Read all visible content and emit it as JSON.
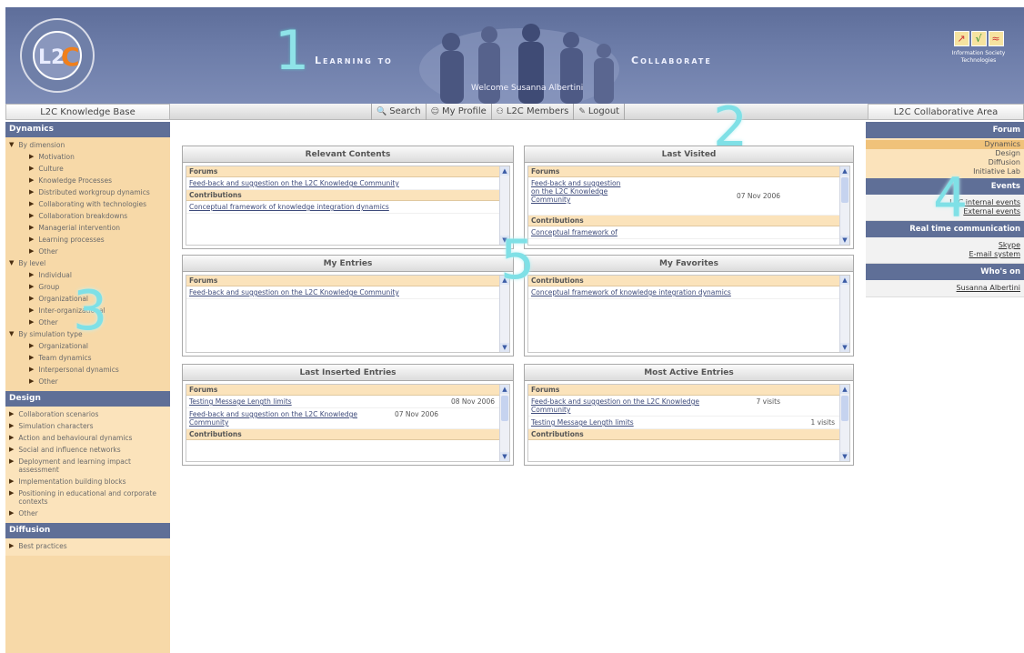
{
  "header": {
    "logo_text": "L2C",
    "logo_ring_text": "LEARNING TO COLLABORATE",
    "title_left": "Learning to",
    "title_right": "Collaborate",
    "welcome": "Welcome Susanna Albertini",
    "info_society_line1": "Information Society",
    "info_society_line2": "Technologies"
  },
  "toolbar": {
    "left_title": "L2C Knowledge Base",
    "right_title": "L2C Collaborative Area",
    "items": [
      {
        "label": "Search",
        "icon": "search-icon"
      },
      {
        "label": "My Profile",
        "icon": "profile-icon"
      },
      {
        "label": "L2C Members",
        "icon": "members-icon"
      },
      {
        "label": "Logout",
        "icon": "logout-icon"
      }
    ]
  },
  "annotations": [
    "1",
    "2",
    "3",
    "4",
    "5"
  ],
  "left": {
    "dynamics_title": "Dynamics",
    "by_dimension": "By dimension",
    "dimension_items": [
      "Motivation",
      "Culture",
      "Knowledge Processes",
      "Distributed workgroup dynamics",
      "Collaborating with technologies",
      "Collaboration breakdowns",
      "Managerial intervention",
      "Learning processes",
      "Other"
    ],
    "by_level": "By level",
    "level_items": [
      "Individual",
      "Group",
      "Organizational",
      "Inter-organizational",
      "Other"
    ],
    "by_simulation": "By simulation type",
    "simulation_items": [
      "Organizational",
      "Team dynamics",
      "Interpersonal dynamics",
      "Other"
    ],
    "design_title": "Design",
    "design_items": [
      "Collaboration scenarios",
      "Simulation characters",
      "Action and behavioural dynamics",
      "Social and influence networks",
      "Deployment and learning impact assessment",
      "Implementation building blocks",
      "Positioning in educational and corporate contexts",
      "Other"
    ],
    "diffusion_title": "Diffusion",
    "diffusion_items": [
      "Best practices"
    ]
  },
  "right": {
    "forum_title": "Forum",
    "forum_items": [
      "Dynamics",
      "Design",
      "Diffusion",
      "Initiative Lab"
    ],
    "events_title": "Events",
    "events_items": [
      "L2C internal events",
      "External events"
    ],
    "realtime_title": "Real time communication",
    "realtime_items": [
      "Skype",
      "E-mail system"
    ],
    "whoson_title": "Who's on",
    "whoson_items": [
      "Susanna Albertini"
    ]
  },
  "panels": {
    "relevant": {
      "title": "Relevant Contents",
      "forums_label": "Forums",
      "forums": [
        {
          "title": "Feed-back and suggestion on the L2C Knowledge Community",
          "date": ""
        }
      ],
      "contrib_label": "Contributions",
      "contribs": [
        {
          "title": "Conceptual framework of knowledge integration dynamics",
          "date": ""
        }
      ]
    },
    "last_visited": {
      "title": "Last Visited",
      "forums_label": "Forums",
      "forums": [
        {
          "title": "Feed-back and suggestion on the L2C Knowledge Community",
          "date": "07 Nov 2006"
        }
      ],
      "contrib_label": "Contributions",
      "contribs": [
        {
          "title": "Conceptual framework of",
          "date": ""
        }
      ]
    },
    "my_entries": {
      "title": "My Entries",
      "forums_label": "Forums",
      "forums": [
        {
          "title": "Feed-back and suggestion on the L2C Knowledge Community",
          "date": ""
        }
      ]
    },
    "my_favorites": {
      "title": "My Favorites",
      "contrib_label": "Contributions",
      "contribs": [
        {
          "title": "Conceptual framework of knowledge integration dynamics",
          "date": ""
        }
      ]
    },
    "last_inserted": {
      "title": "Last Inserted Entries",
      "forums_label": "Forums",
      "forums": [
        {
          "title": "Testing Message Length limits",
          "date": "08 Nov 2006"
        },
        {
          "title": "Feed-back and suggestion on the L2C Knowledge Community",
          "date": "07 Nov 2006"
        }
      ],
      "contrib_label": "Contributions"
    },
    "most_active": {
      "title": "Most Active Entries",
      "forums_label": "Forums",
      "forums": [
        {
          "title": "Feed-back and suggestion on the L2C Knowledge Community",
          "date": "7 visits"
        },
        {
          "title": "Testing Message Length limits",
          "date": "1 visits"
        }
      ],
      "contrib_label": "Contributions"
    }
  }
}
